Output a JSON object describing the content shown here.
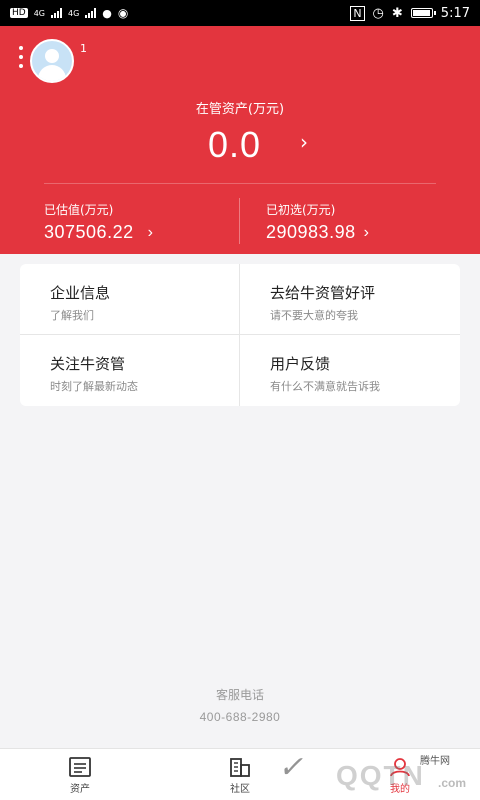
{
  "status_bar": {
    "left_badges": [
      "HD",
      "4G",
      "4G"
    ],
    "time": "5:17",
    "battery_level": 0.9,
    "icons": [
      "nfc-icon",
      "alarm-icon",
      "bluetooth-icon",
      "battery-icon"
    ]
  },
  "header": {
    "user_name": "1",
    "assets_label": "在管资产(万元)",
    "assets_value": "0.0",
    "stat_left": {
      "label": "已估值(万元)",
      "value": "307506.22"
    },
    "stat_right": {
      "label": "已初选(万元)",
      "value": "290983.98"
    },
    "accent_color": "#e3353e"
  },
  "menu": [
    {
      "title": "企业信息",
      "subtitle": "了解我们"
    },
    {
      "title": "去给牛资管好评",
      "subtitle": "请不要大意的夸我"
    },
    {
      "title": "关注牛资管",
      "subtitle": "时刻了解最新动态"
    },
    {
      "title": "用户反馈",
      "subtitle": "有什么不满意就告诉我"
    }
  ],
  "service": {
    "label": "客服电话",
    "phone": "400-688-2980"
  },
  "tabbar": {
    "tabs": [
      {
        "label": "资产",
        "icon": "document-icon"
      },
      {
        "label": "社区",
        "icon": "building-icon"
      },
      {
        "label": "我的",
        "icon": "user-icon"
      }
    ]
  },
  "watermark": {
    "small_text": "腾牛网",
    "brand_text": "QQTN",
    "suffix": ".com"
  }
}
